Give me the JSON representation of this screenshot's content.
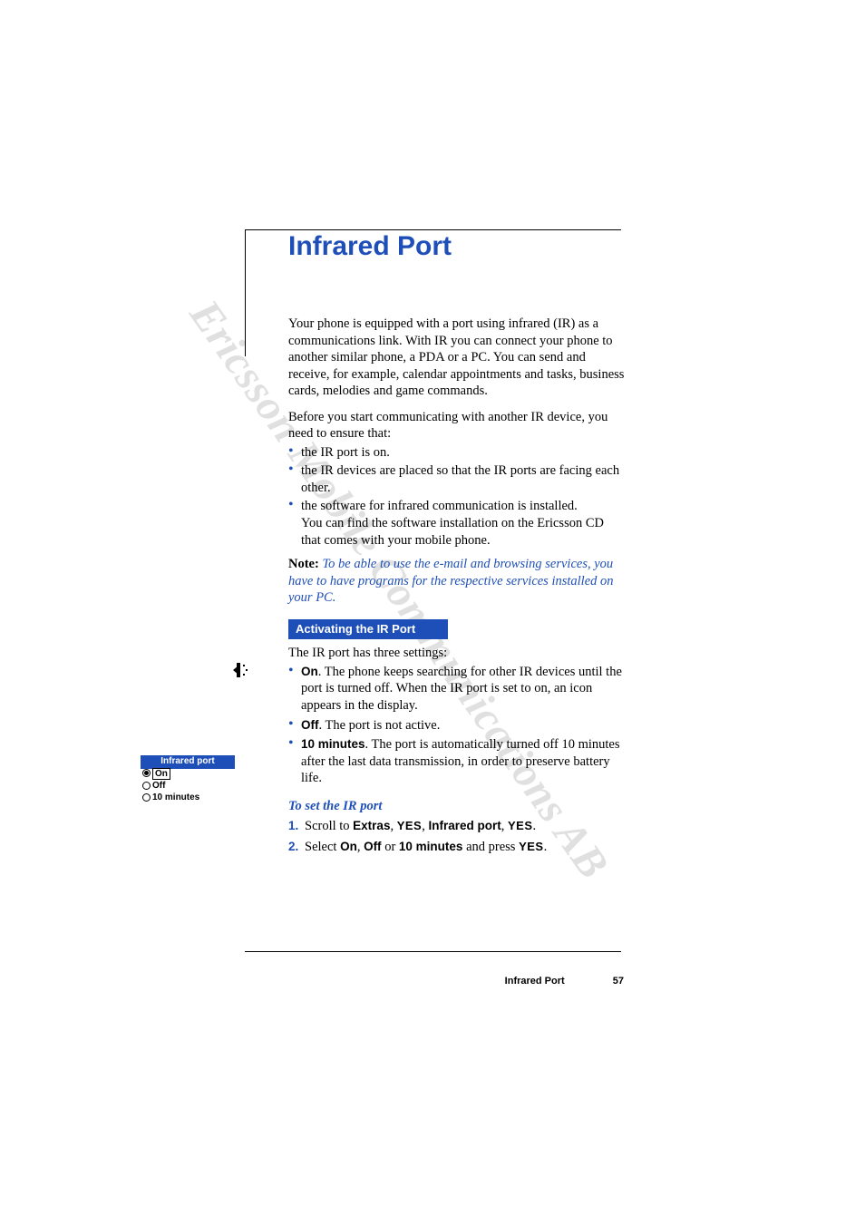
{
  "watermark": "Ericsson Mobile Communications AB",
  "title": "Infrared Port",
  "intro_p1": "Your phone is equipped with a port using infrared (IR) as a communications link. With IR you can connect your phone to another similar phone, a PDA or a PC. You can send and receive, for example, calendar appointments and tasks, business cards, melodies and game commands.",
  "intro_p2": "Before you start communicating with another IR device, you need to ensure that:",
  "pre_bullets": {
    "b1": "the IR port is on.",
    "b2": "the IR devices are placed so that the IR ports are facing each other.",
    "b3a": "the software for infrared communication is installed.",
    "b3b": "You can find the software installation on the Ericsson CD that comes with your mobile phone."
  },
  "note": {
    "label": "Note:",
    "text": " To be able to use the e-mail and browsing services, you have to have programs for the respective services installed on your PC."
  },
  "section_bar": "Activating the IR Port",
  "settings_intro": "The IR port has three settings:",
  "options": {
    "on": {
      "label": "On",
      "text": ". The phone keeps searching for other IR devices until the port is turned off. When the IR port is set to on, an icon appears in the display."
    },
    "off": {
      "label": "Off",
      "text": ". The port is not active."
    },
    "ten": {
      "label": "10 minutes",
      "text": ". The port is automatically turned off 10 minutes after the last data transmission, in order to preserve battery life."
    }
  },
  "subhead": "To set the IR port",
  "steps": {
    "s1": {
      "num": "1.",
      "pre": "Scroll to ",
      "w1": "Extras",
      "sep1": ", ",
      "k1": "YES",
      "sep2": ", ",
      "w2": "Infrared port",
      "sep3": ", ",
      "k2": "YES",
      "end": "."
    },
    "s2": {
      "num": "2.",
      "pre": "Select ",
      "w1": "On",
      "sep1": ", ",
      "w2": "Off",
      "mid": " or ",
      "w3": "10 minutes",
      "post": " and press ",
      "k1": "YES",
      "end": "."
    }
  },
  "mini": {
    "header": "Infrared port",
    "on": "On",
    "off": "Off",
    "ten": "10 minutes"
  },
  "footer": {
    "title": "Infrared Port",
    "page": "57"
  }
}
